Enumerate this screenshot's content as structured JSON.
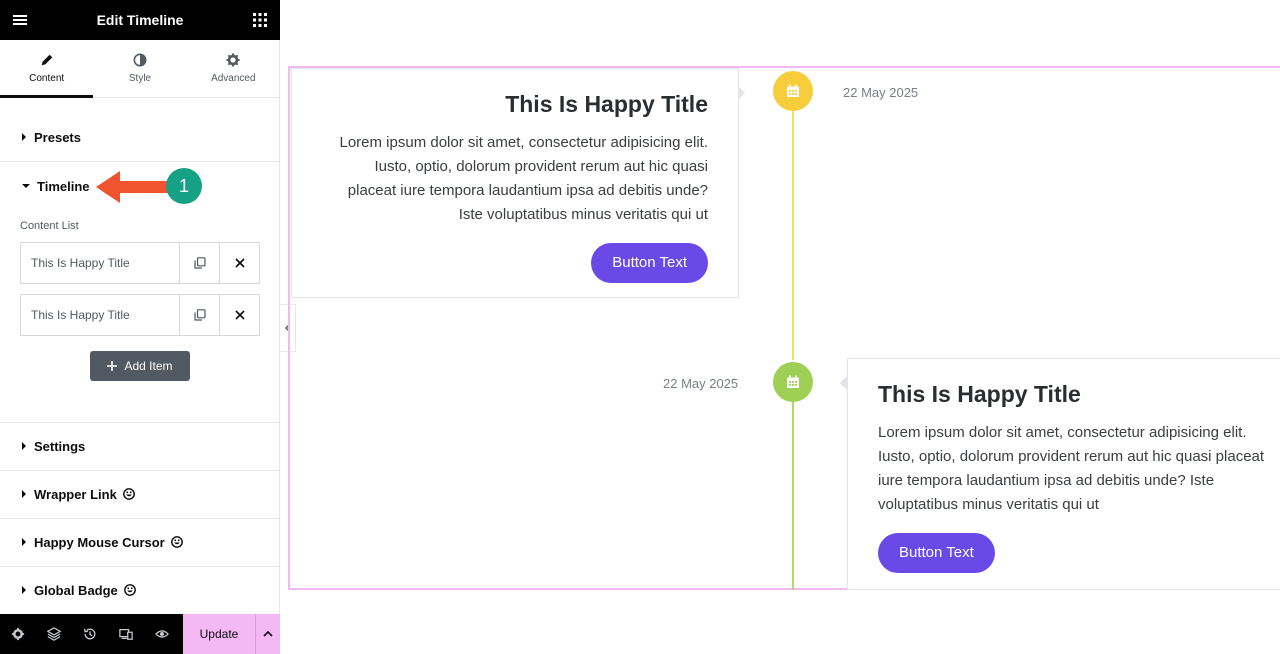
{
  "header": {
    "title": "Edit Timeline"
  },
  "tabs": [
    {
      "label": "Content",
      "icon": "pencil-icon"
    },
    {
      "label": "Style",
      "icon": "half-circle-icon"
    },
    {
      "label": "Advanced",
      "icon": "gear-icon"
    }
  ],
  "sections": {
    "presets": "Presets",
    "timeline": "Timeline",
    "settings": "Settings",
    "wrapper_link": "Wrapper Link",
    "happy_mouse_cursor": "Happy Mouse Cursor",
    "global_badge": "Global Badge"
  },
  "content_list": {
    "label": "Content List",
    "items": [
      "This Is Happy Title",
      "This Is Happy Title"
    ],
    "add_label": "Add Item"
  },
  "annotation": {
    "step": "1"
  },
  "footer": {
    "update_label": "Update"
  },
  "timeline": {
    "items": [
      {
        "title": "This Is Happy Title",
        "text": "Lorem ipsum dolor sit amet, consectetur adipisicing elit. Iusto, optio, dolorum provident rerum aut hic quasi placeat iure tempora laudantium ipsa ad debitis unde? Iste voluptatibus minus veritatis qui ut",
        "button": "Button Text",
        "date": "22 May 2025",
        "dot_color": "#f7cd3c"
      },
      {
        "title": "This Is Happy Title",
        "text": "Lorem ipsum dolor sit amet, consectetur adipisicing elit. Iusto, optio, dolorum provident rerum aut hic quasi placeat iure tempora laudantium ipsa ad debitis unde? Iste voluptatibus minus veritatis qui ut",
        "button": "Button Text",
        "date": "22 May 2025",
        "dot_color": "#9fcf55"
      }
    ]
  },
  "colors": {
    "accent": "#6a4ae6",
    "update": "#f4b8f5",
    "badge": "#16a085",
    "arrow": "#f0532e"
  }
}
